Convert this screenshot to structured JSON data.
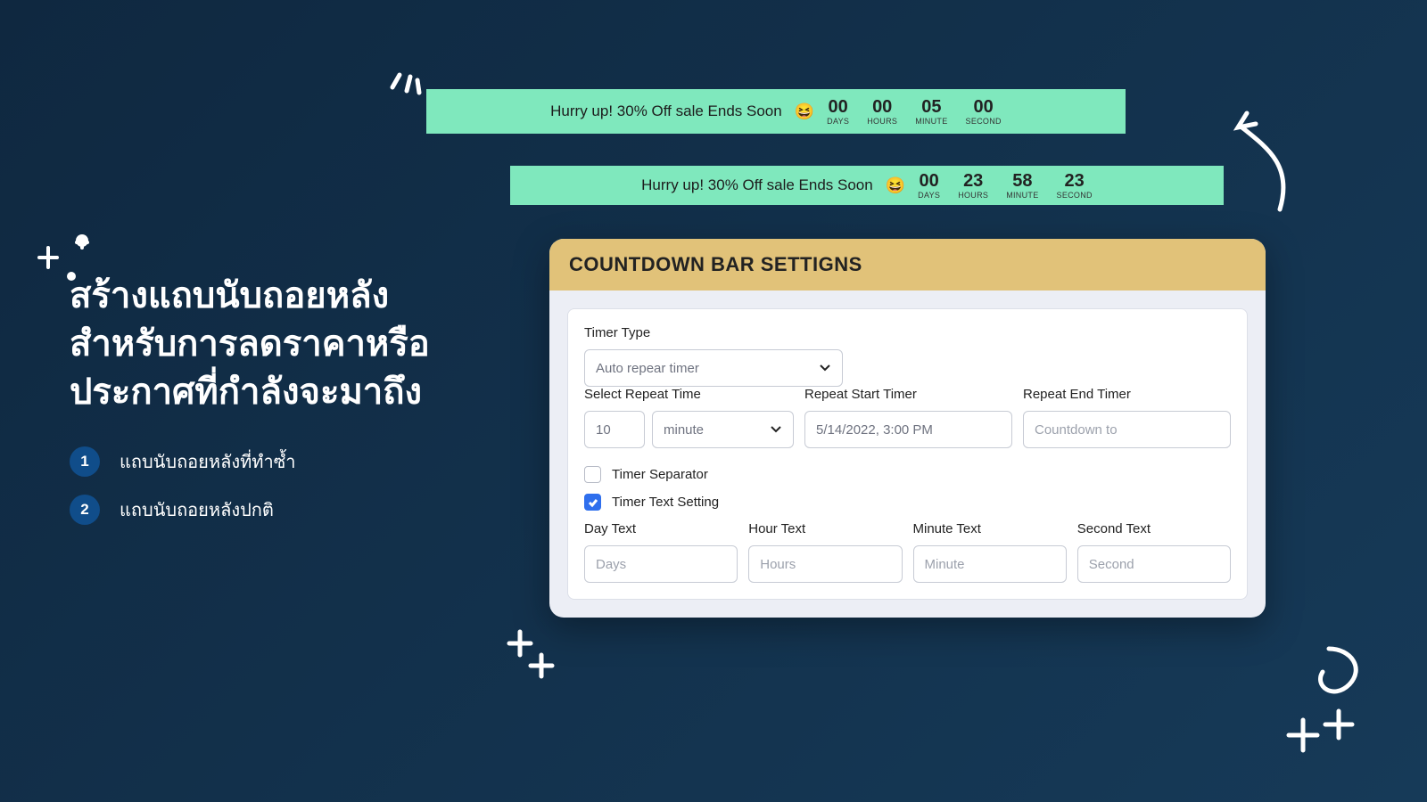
{
  "hero": {
    "title": "สร้างแถบนับถอยหลังสำหรับการลดราคาหรือประกาศที่กำลังจะมาถึง",
    "bullets": [
      "แถบนับถอยหลังที่ทำซ้ำ",
      "แถบนับถอยหลังปกติ"
    ]
  },
  "bars": [
    {
      "msg": "Hurry up! 30% Off sale Ends Soon",
      "units": [
        {
          "num": "00",
          "label": "DAYS"
        },
        {
          "num": "00",
          "label": "HOURS"
        },
        {
          "num": "05",
          "label": "MINUTE"
        },
        {
          "num": "00",
          "label": "SECOND"
        }
      ]
    },
    {
      "msg": "Hurry up! 30% Off sale Ends Soon",
      "units": [
        {
          "num": "00",
          "label": "DAYS"
        },
        {
          "num": "23",
          "label": "HOURS"
        },
        {
          "num": "58",
          "label": "MINUTE"
        },
        {
          "num": "23",
          "label": "SECOND"
        }
      ]
    }
  ],
  "panel": {
    "title": "COUNTDOWN BAR SETTIGNS",
    "timerType": {
      "label": "Timer Type",
      "value": "Auto repear timer"
    },
    "repeatTime": {
      "label": "Select Repeat Time",
      "value": "10",
      "unit": "minute"
    },
    "repeatStart": {
      "label": "Repeat Start Timer",
      "value": "5/14/2022, 3:00 PM"
    },
    "repeatEnd": {
      "label": "Repeat End Timer",
      "placeholder": "Countdown to"
    },
    "checks": {
      "separator": {
        "label": "Timer Separator",
        "checked": false
      },
      "textSetting": {
        "label": "Timer Text Setting",
        "checked": true
      }
    },
    "textFields": {
      "day": {
        "label": "Day Text",
        "placeholder": "Days"
      },
      "hour": {
        "label": "Hour Text",
        "placeholder": "Hours"
      },
      "minute": {
        "label": "Minute Text",
        "placeholder": "Minute"
      },
      "second": {
        "label": "Second Text",
        "placeholder": "Second"
      }
    }
  }
}
